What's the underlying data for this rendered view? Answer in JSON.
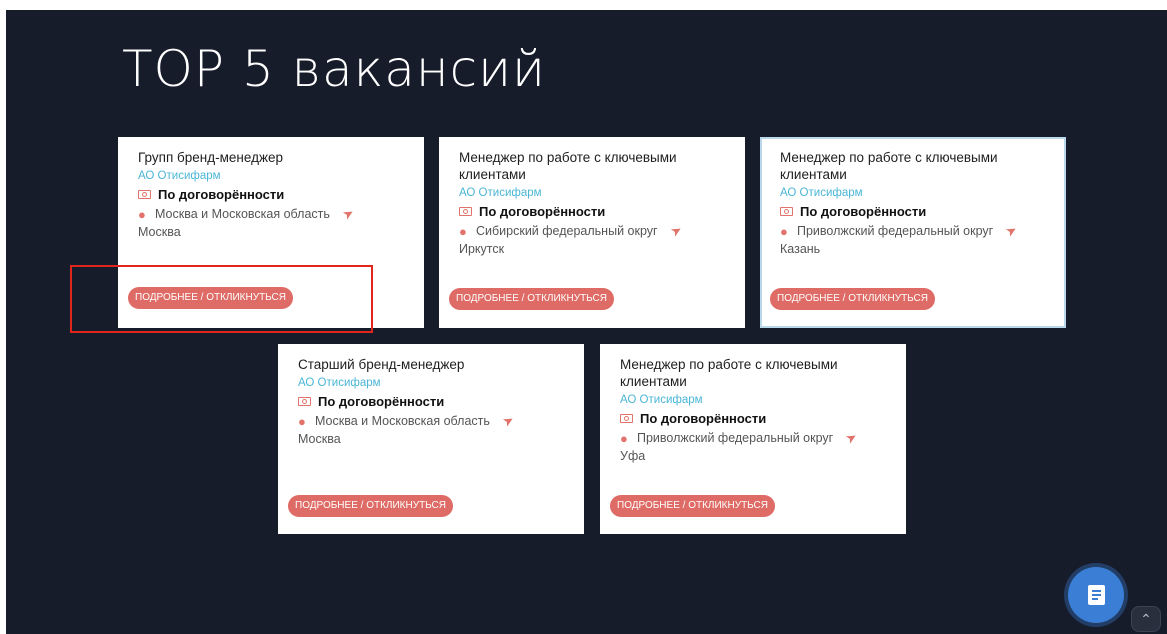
{
  "page_title": "TOP 5 вакансий",
  "cta_label": "ПОДРОБНЕЕ / ОТКЛИКНУТЬСЯ",
  "colors": {
    "background": "#171c2b",
    "accent": "#df6b66",
    "company": "#4bb6d6",
    "fab": "#3a7fd5",
    "highlight": "#e0251d"
  },
  "icons": {
    "salary": "money-icon",
    "location": "map-pin-icon",
    "navigate": "navigation-arrow-icon",
    "fab": "document-icon",
    "scroll": "chevron-up-icon"
  },
  "vacancies": [
    {
      "title": "Групп бренд-менеджер",
      "company": "АО Отисифарм",
      "salary": "По договорённости",
      "region": "Москва и Московская область",
      "city": "Москва"
    },
    {
      "title": "Менеджер по работе с ключевыми клиентами",
      "company": "АО Отисифарм",
      "salary": "По договорённости",
      "region": "Сибирский федеральный округ",
      "city": "Иркутск"
    },
    {
      "title": "Менеджер по работе с ключевыми клиентами",
      "company": "АО Отисифарм",
      "salary": "По договорённости",
      "region": "Приволжский федеральный округ",
      "city": "Казань"
    },
    {
      "title": "Старший бренд-менеджер",
      "company": "АО Отисифарм",
      "salary": "По договорённости",
      "region": "Москва и Московская область",
      "city": "Москва"
    },
    {
      "title": "Менеджер по работе с ключевыми клиентами",
      "company": "АО Отисифарм",
      "salary": "По договорённости",
      "region": "Приволжский федеральный округ",
      "city": "Уфа"
    }
  ]
}
